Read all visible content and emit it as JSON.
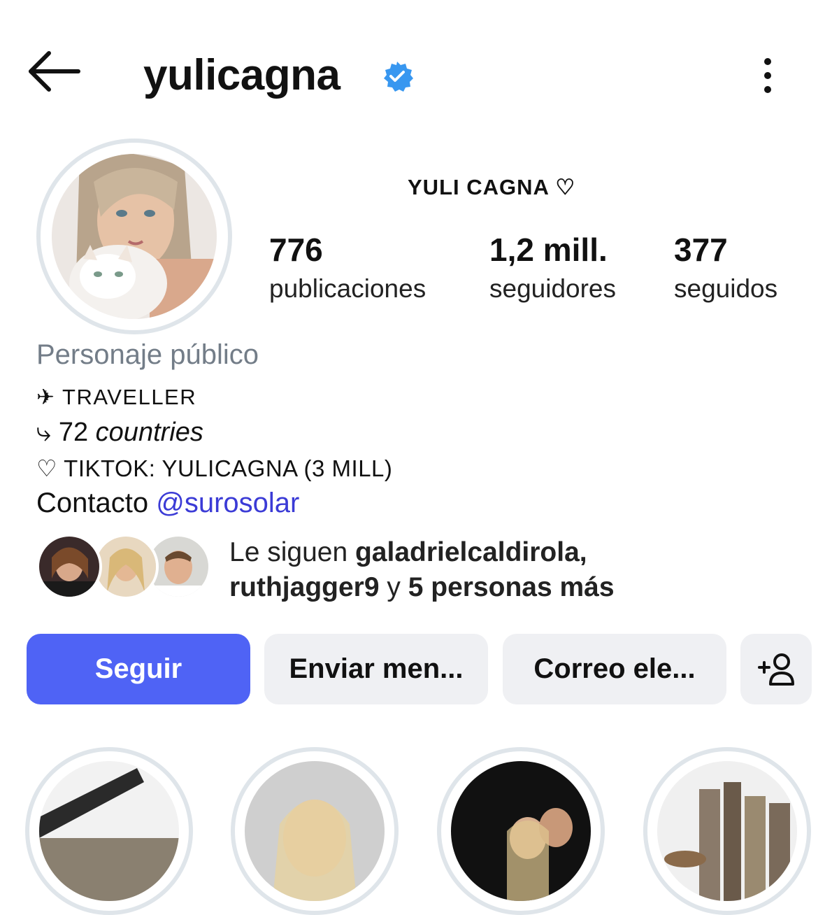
{
  "header": {
    "username": "yulicagna",
    "back_icon": "arrow-left-icon",
    "verified_icon": "verified-badge-icon",
    "more_icon": "more-vertical-icon"
  },
  "profile": {
    "display_name": "YULI CAGNA ♡",
    "stats": [
      {
        "value": "776",
        "label": "publicaciones"
      },
      {
        "value": "1,2 mill.",
        "label": "seguidores"
      },
      {
        "value": "377",
        "label": "seguidos"
      }
    ],
    "category": "Personaje público",
    "bio": {
      "line1": "✈ TRAVELLER",
      "line2_prefix": "⤷ 72 ",
      "line2_italic": "countries",
      "line3": "♡ TIKTOK: YULICAGNA (3 MILL)",
      "contact_label": "Contacto ",
      "contact_link": "@surosolar"
    },
    "followed_by": {
      "prefix": "Le siguen ",
      "user1": "galadrielcaldirola,",
      "user2": "ruthjagger9",
      "connector": " y ",
      "more": "5 personas más"
    }
  },
  "actions": {
    "follow": "Seguir",
    "message": "Enviar men...",
    "email": "Correo ele...",
    "add_icon": "add-person-icon"
  },
  "colors": {
    "accent": "#4f63f5",
    "verified": "#3897f0",
    "link": "#3b3bd6",
    "button_bg": "#eff0f3",
    "ring": "#dfe5ea"
  }
}
